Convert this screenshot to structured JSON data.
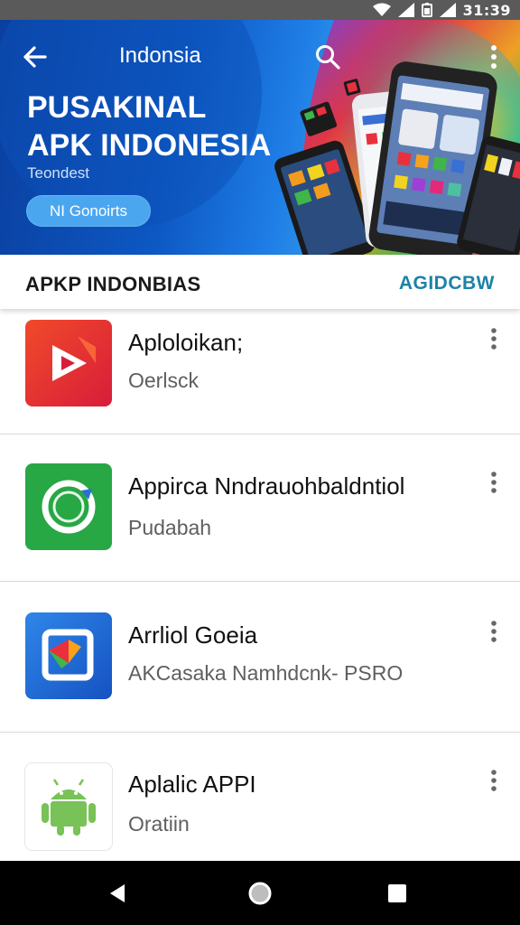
{
  "status_bar": {
    "time": "31:39"
  },
  "header": {
    "title": "Indonsia",
    "headline_line1": "PUSAKINAL",
    "headline_line2": "APK INDONESIA",
    "tagline": "Teondest",
    "cta_label": "NI Gonoirts",
    "colors": {
      "hero_blue": "#0d58c4",
      "cta_blue": "#4ba6f0"
    }
  },
  "section": {
    "title": "APKP INDONBIAS",
    "action": "AGIDCBW",
    "action_color": "#1c82a8"
  },
  "apps": [
    {
      "name": "Aplolоikan;",
      "subtitle": "Oerlsck",
      "icon": "play-icon"
    },
    {
      "name": "Appirca Nndrauohbaldntiol",
      "subtitle": "Pudabah",
      "icon": "refresh-ring-icon"
    },
    {
      "name": "Arrliol Goeia",
      "subtitle": "AKCasaka  Namhdcnk- PSRO",
      "icon": "folded-square-icon"
    },
    {
      "name": "Aplalic APPI",
      "subtitle": "Oratiin",
      "icon": "android-icon"
    }
  ],
  "nav": {
    "back": "back-triangle-icon",
    "home": "home-circle-icon",
    "recents": "recents-square-icon"
  }
}
